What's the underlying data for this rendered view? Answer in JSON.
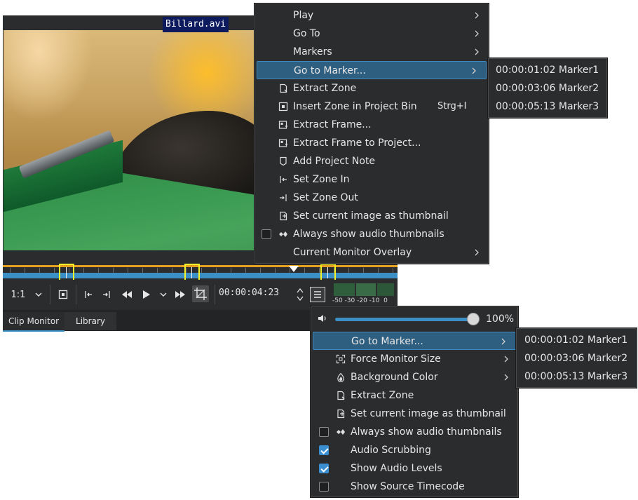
{
  "monitor": {
    "clip_name": "Billard.avi",
    "zoom": "1:1",
    "timecode": "00:00:04:23",
    "level_scale": "-50 -30 -20 -10  0",
    "tabs": [
      {
        "label": "Clip Monitor"
      },
      {
        "label": "Library"
      }
    ],
    "icons": {
      "zoom_dropdown": "chevron-down-icon",
      "insert_zone": "insert-zone-icon",
      "zone_in": "set-zone-in-icon",
      "zone_out": "set-zone-out-icon",
      "rewind": "rewind-icon",
      "play": "play-icon",
      "play_dropdown": "chevron-down-icon",
      "forward": "fast-forward-icon",
      "crop": "crop-icon",
      "menu": "hamburger-menu-icon"
    }
  },
  "menu_top": {
    "items": [
      {
        "label": "Play",
        "submenu": true
      },
      {
        "label": "Go To",
        "submenu": true
      },
      {
        "label": "Markers",
        "submenu": true
      },
      {
        "label": "Go to Marker...",
        "submenu": true,
        "highlighted": true
      },
      {
        "label": "Extract Zone",
        "icon": "extract-zone-icon"
      },
      {
        "label": "Insert Zone in Project Bin",
        "shortcut": "Strg+I",
        "icon": "insert-zone-icon"
      },
      {
        "label": "Extract Frame...",
        "icon": "extract-frame-icon"
      },
      {
        "label": "Extract Frame to Project...",
        "icon": "extract-frame-project-icon"
      },
      {
        "label": "Add Project Note",
        "icon": "note-icon"
      },
      {
        "label": "Set Zone In",
        "icon": "set-zone-in-icon"
      },
      {
        "label": "Set Zone Out",
        "icon": "set-zone-out-icon"
      },
      {
        "label": "Set current image as thumbnail",
        "icon": "thumbnail-icon"
      },
      {
        "label": "Always show audio thumbnails",
        "checkbox": true,
        "checked": false,
        "icon": "audio-thumbnail-icon"
      },
      {
        "label": "Current Monitor Overlay",
        "submenu": true
      }
    ]
  },
  "submenu_top": {
    "items": [
      {
        "label": "00:00:01:02 Marker1"
      },
      {
        "label": "00:00:03:06 Marker2"
      },
      {
        "label": "00:00:05:13 Marker3"
      }
    ]
  },
  "menu_bottom": {
    "volume": {
      "value_label": "100%",
      "level": 1.0,
      "icon": "volume-icon"
    },
    "items": [
      {
        "label": "Go to Marker...",
        "submenu": true,
        "highlighted": true
      },
      {
        "label": "Force Monitor Size",
        "submenu": true,
        "icon": "monitor-size-icon"
      },
      {
        "label": "Background Color",
        "submenu": true,
        "icon": "color-drop-icon"
      },
      {
        "label": "Extract Zone",
        "icon": "extract-zone-icon"
      },
      {
        "label": "Set current image as thumbnail",
        "icon": "thumbnail-icon"
      },
      {
        "label": "Always show audio thumbnails",
        "checkbox": true,
        "checked": false,
        "icon": "audio-thumbnail-icon"
      },
      {
        "label": "Audio Scrubbing",
        "checkbox": true,
        "checked": true
      },
      {
        "label": "Show Audio Levels",
        "checkbox": true,
        "checked": true
      },
      {
        "label": "Show Source Timecode",
        "checkbox": true,
        "checked": false
      }
    ]
  },
  "submenu_bottom": {
    "items": [
      {
        "label": "00:00:01:02 Marker1"
      },
      {
        "label": "00:00:03:06 Marker2"
      },
      {
        "label": "00:00:05:13 Marker3"
      }
    ]
  },
  "colors": {
    "panel": "#2b2c2e",
    "highlight": "#2f5f80",
    "accent_blue": "#3b8fc5",
    "zone_orange": "#e6a020",
    "marker_highlight": "#f2f22a",
    "clip_name_bg": "#0d1b5e"
  }
}
